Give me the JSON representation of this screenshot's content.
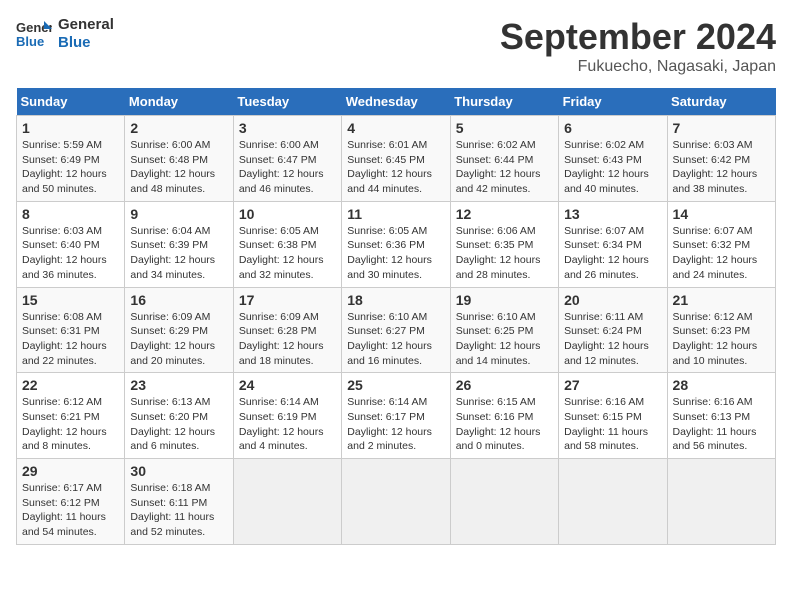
{
  "logo": {
    "text_general": "General",
    "text_blue": "Blue"
  },
  "title": "September 2024",
  "location": "Fukuecho, Nagasaki, Japan",
  "days_header": [
    "Sunday",
    "Monday",
    "Tuesday",
    "Wednesday",
    "Thursday",
    "Friday",
    "Saturday"
  ],
  "weeks": [
    [
      {
        "day": "1",
        "sunrise": "Sunrise: 5:59 AM",
        "sunset": "Sunset: 6:49 PM",
        "daylight": "Daylight: 12 hours and 50 minutes."
      },
      {
        "day": "2",
        "sunrise": "Sunrise: 6:00 AM",
        "sunset": "Sunset: 6:48 PM",
        "daylight": "Daylight: 12 hours and 48 minutes."
      },
      {
        "day": "3",
        "sunrise": "Sunrise: 6:00 AM",
        "sunset": "Sunset: 6:47 PM",
        "daylight": "Daylight: 12 hours and 46 minutes."
      },
      {
        "day": "4",
        "sunrise": "Sunrise: 6:01 AM",
        "sunset": "Sunset: 6:45 PM",
        "daylight": "Daylight: 12 hours and 44 minutes."
      },
      {
        "day": "5",
        "sunrise": "Sunrise: 6:02 AM",
        "sunset": "Sunset: 6:44 PM",
        "daylight": "Daylight: 12 hours and 42 minutes."
      },
      {
        "day": "6",
        "sunrise": "Sunrise: 6:02 AM",
        "sunset": "Sunset: 6:43 PM",
        "daylight": "Daylight: 12 hours and 40 minutes."
      },
      {
        "day": "7",
        "sunrise": "Sunrise: 6:03 AM",
        "sunset": "Sunset: 6:42 PM",
        "daylight": "Daylight: 12 hours and 38 minutes."
      }
    ],
    [
      {
        "day": "8",
        "sunrise": "Sunrise: 6:03 AM",
        "sunset": "Sunset: 6:40 PM",
        "daylight": "Daylight: 12 hours and 36 minutes."
      },
      {
        "day": "9",
        "sunrise": "Sunrise: 6:04 AM",
        "sunset": "Sunset: 6:39 PM",
        "daylight": "Daylight: 12 hours and 34 minutes."
      },
      {
        "day": "10",
        "sunrise": "Sunrise: 6:05 AM",
        "sunset": "Sunset: 6:38 PM",
        "daylight": "Daylight: 12 hours and 32 minutes."
      },
      {
        "day": "11",
        "sunrise": "Sunrise: 6:05 AM",
        "sunset": "Sunset: 6:36 PM",
        "daylight": "Daylight: 12 hours and 30 minutes."
      },
      {
        "day": "12",
        "sunrise": "Sunrise: 6:06 AM",
        "sunset": "Sunset: 6:35 PM",
        "daylight": "Daylight: 12 hours and 28 minutes."
      },
      {
        "day": "13",
        "sunrise": "Sunrise: 6:07 AM",
        "sunset": "Sunset: 6:34 PM",
        "daylight": "Daylight: 12 hours and 26 minutes."
      },
      {
        "day": "14",
        "sunrise": "Sunrise: 6:07 AM",
        "sunset": "Sunset: 6:32 PM",
        "daylight": "Daylight: 12 hours and 24 minutes."
      }
    ],
    [
      {
        "day": "15",
        "sunrise": "Sunrise: 6:08 AM",
        "sunset": "Sunset: 6:31 PM",
        "daylight": "Daylight: 12 hours and 22 minutes."
      },
      {
        "day": "16",
        "sunrise": "Sunrise: 6:09 AM",
        "sunset": "Sunset: 6:29 PM",
        "daylight": "Daylight: 12 hours and 20 minutes."
      },
      {
        "day": "17",
        "sunrise": "Sunrise: 6:09 AM",
        "sunset": "Sunset: 6:28 PM",
        "daylight": "Daylight: 12 hours and 18 minutes."
      },
      {
        "day": "18",
        "sunrise": "Sunrise: 6:10 AM",
        "sunset": "Sunset: 6:27 PM",
        "daylight": "Daylight: 12 hours and 16 minutes."
      },
      {
        "day": "19",
        "sunrise": "Sunrise: 6:10 AM",
        "sunset": "Sunset: 6:25 PM",
        "daylight": "Daylight: 12 hours and 14 minutes."
      },
      {
        "day": "20",
        "sunrise": "Sunrise: 6:11 AM",
        "sunset": "Sunset: 6:24 PM",
        "daylight": "Daylight: 12 hours and 12 minutes."
      },
      {
        "day": "21",
        "sunrise": "Sunrise: 6:12 AM",
        "sunset": "Sunset: 6:23 PM",
        "daylight": "Daylight: 12 hours and 10 minutes."
      }
    ],
    [
      {
        "day": "22",
        "sunrise": "Sunrise: 6:12 AM",
        "sunset": "Sunset: 6:21 PM",
        "daylight": "Daylight: 12 hours and 8 minutes."
      },
      {
        "day": "23",
        "sunrise": "Sunrise: 6:13 AM",
        "sunset": "Sunset: 6:20 PM",
        "daylight": "Daylight: 12 hours and 6 minutes."
      },
      {
        "day": "24",
        "sunrise": "Sunrise: 6:14 AM",
        "sunset": "Sunset: 6:19 PM",
        "daylight": "Daylight: 12 hours and 4 minutes."
      },
      {
        "day": "25",
        "sunrise": "Sunrise: 6:14 AM",
        "sunset": "Sunset: 6:17 PM",
        "daylight": "Daylight: 12 hours and 2 minutes."
      },
      {
        "day": "26",
        "sunrise": "Sunrise: 6:15 AM",
        "sunset": "Sunset: 6:16 PM",
        "daylight": "Daylight: 12 hours and 0 minutes."
      },
      {
        "day": "27",
        "sunrise": "Sunrise: 6:16 AM",
        "sunset": "Sunset: 6:15 PM",
        "daylight": "Daylight: 11 hours and 58 minutes."
      },
      {
        "day": "28",
        "sunrise": "Sunrise: 6:16 AM",
        "sunset": "Sunset: 6:13 PM",
        "daylight": "Daylight: 11 hours and 56 minutes."
      }
    ],
    [
      {
        "day": "29",
        "sunrise": "Sunrise: 6:17 AM",
        "sunset": "Sunset: 6:12 PM",
        "daylight": "Daylight: 11 hours and 54 minutes."
      },
      {
        "day": "30",
        "sunrise": "Sunrise: 6:18 AM",
        "sunset": "Sunset: 6:11 PM",
        "daylight": "Daylight: 11 hours and 52 minutes."
      },
      null,
      null,
      null,
      null,
      null
    ]
  ]
}
